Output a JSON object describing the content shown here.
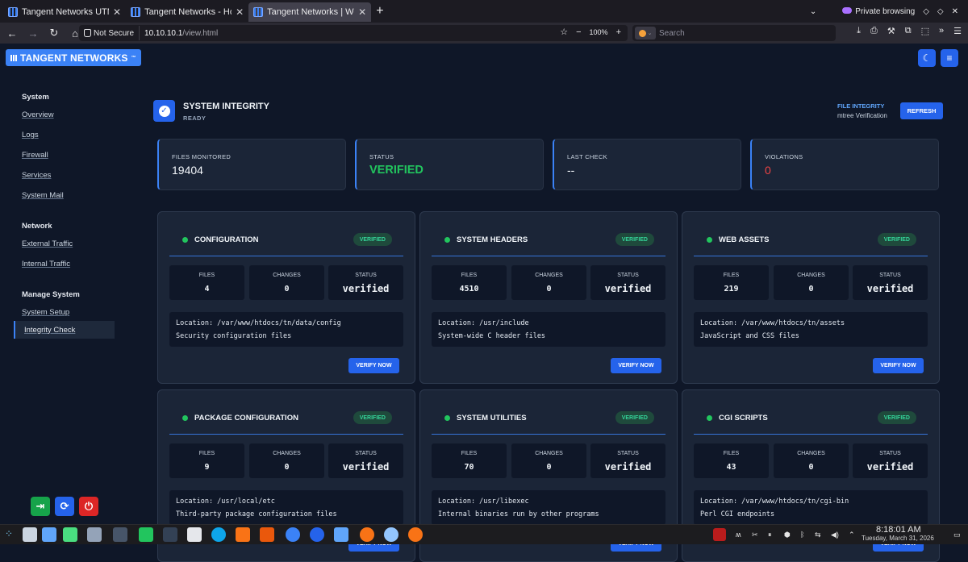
{
  "browser": {
    "tabs": [
      {
        "title": "Tangent Networks UTM —"
      },
      {
        "title": "Tangent Networks - Home"
      },
      {
        "title": "Tangent Networks | Web i"
      }
    ],
    "private_label": "Private browsing",
    "not_secure_label": "Not Secure",
    "url_host": "10.10.10.1",
    "url_path": "/view.html",
    "zoom": "100%",
    "search_placeholder": "Search"
  },
  "app": {
    "brand": "TANGENT NETWORKS",
    "brand_tm": "™"
  },
  "sidebar": {
    "sections": [
      {
        "title": "System",
        "items": [
          "Overview",
          "Logs",
          "Firewall",
          "Services",
          "System Mail"
        ]
      },
      {
        "title": "Network",
        "items": [
          "External Traffic",
          "Internal Traffic"
        ]
      },
      {
        "title": "Manage System",
        "items": [
          "System Setup",
          "Integrity Check"
        ]
      }
    ],
    "active_item": "Integrity Check"
  },
  "page": {
    "title": "SYSTEM INTEGRITY",
    "subtitle": "READY",
    "section_link": "FILE INTEGRITY",
    "section_sub": "mtree Verification",
    "refresh_label": "REFRESH"
  },
  "stats": [
    {
      "label": "FILES MONITORED",
      "value": "19404"
    },
    {
      "label": "STATUS",
      "value": "VERIFIED"
    },
    {
      "label": "LAST CHECK",
      "value": "--"
    },
    {
      "label": "VIOLATIONS",
      "value": "0"
    }
  ],
  "metric_labels": {
    "files": "FILES",
    "changes": "CHANGES",
    "status": "STATUS"
  },
  "cards": [
    {
      "title": "CONFIGURATION",
      "badge": "VERIFIED",
      "files": "4",
      "changes": "0",
      "status": "verified",
      "location": "Location: /var/www/htdocs/tn/data/config",
      "description": "Security configuration files",
      "button": "VERIFY NOW"
    },
    {
      "title": "SYSTEM HEADERS",
      "badge": "VERIFIED",
      "files": "4510",
      "changes": "0",
      "status": "verified",
      "location": "Location: /usr/include",
      "description": "System-wide C header files",
      "button": "VERIFY NOW"
    },
    {
      "title": "WEB ASSETS",
      "badge": "VERIFIED",
      "files": "219",
      "changes": "0",
      "status": "verified",
      "location": "Location: /var/www/htdocs/tn/assets",
      "description": "JavaScript and CSS files",
      "button": "VERIFY NOW"
    },
    {
      "title": "PACKAGE CONFIGURATION",
      "badge": "VERIFIED",
      "files": "9",
      "changes": "0",
      "status": "verified",
      "location": "Location: /usr/local/etc",
      "description": "Third-party package configuration files",
      "button": "VERIFY NOW"
    },
    {
      "title": "SYSTEM UTILITIES",
      "badge": "VERIFIED",
      "files": "70",
      "changes": "0",
      "status": "verified",
      "location": "Location: /usr/libexec",
      "description": "Internal binaries run by other programs",
      "button": "VERIFY NOW"
    },
    {
      "title": "CGI SCRIPTS",
      "badge": "VERIFIED",
      "files": "43",
      "changes": "0",
      "status": "verified",
      "location": "Location: /var/www/htdocs/tn/cgi-bin",
      "description": "Perl CGI endpoints",
      "button": "VERIFY NOW"
    }
  ],
  "taskbar": {
    "time": "8:18:01 AM",
    "date": "Tuesday, March 31, 2026"
  },
  "colors": {
    "accent": "#2563eb",
    "ok": "#22c55e",
    "danger": "#ef4444",
    "bg": "#0f1728",
    "card": "#1b2537"
  }
}
